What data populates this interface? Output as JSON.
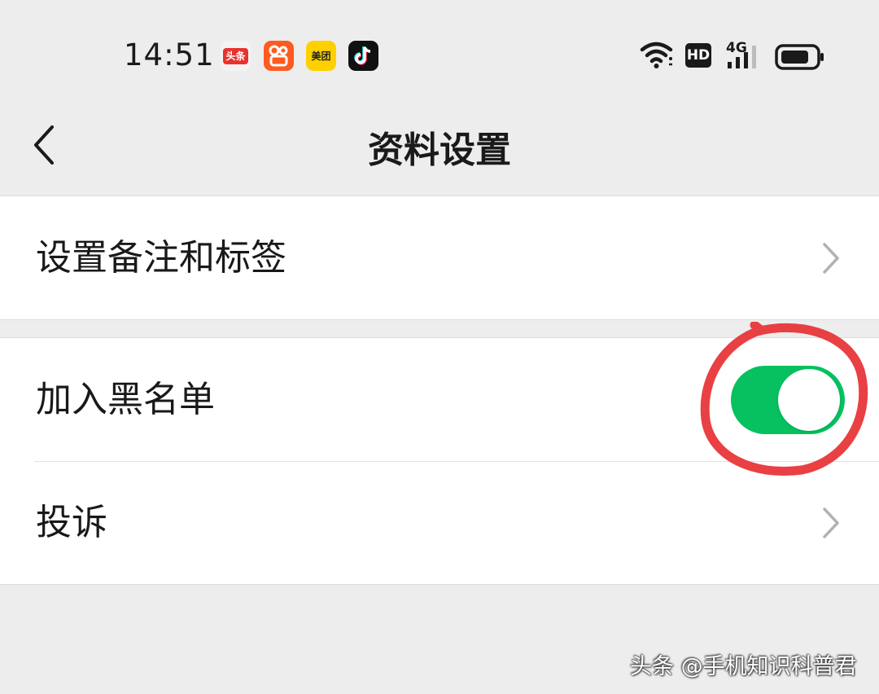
{
  "status_bar": {
    "time": "14:51",
    "apps": [
      {
        "name": "toutiao",
        "label": "头条"
      },
      {
        "name": "kuaishou-jisuban"
      },
      {
        "name": "meituan",
        "label": "美团"
      },
      {
        "name": "douyin",
        "glyph": "♪"
      }
    ],
    "network": "4G",
    "hd": "HD",
    "icons": [
      "wifi-icon",
      "hd-icon",
      "signal-4g-icon",
      "battery-icon"
    ]
  },
  "nav": {
    "title": "资料设置",
    "back_icon": "chevron-left-icon"
  },
  "settings": {
    "remark_tags": "设置备注和标签",
    "blacklist": "加入黑名单",
    "blacklist_enabled": true,
    "complain": "投诉"
  },
  "colors": {
    "toggle_on": "#07c160",
    "background": "#ededed",
    "annotation_circle": "#e8363a"
  },
  "watermark": "头条 @手机知识科普君"
}
